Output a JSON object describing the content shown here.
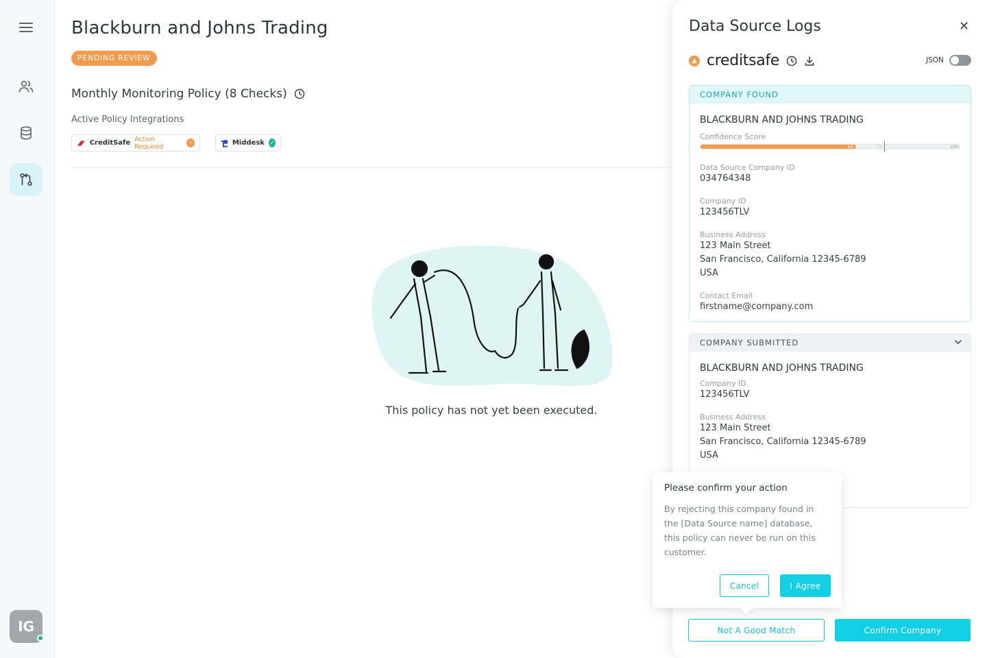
{
  "sidebar": {
    "avatar_initials": "IG",
    "items": [
      {
        "icon": "menu-icon"
      },
      {
        "icon": "users-icon"
      },
      {
        "icon": "database-icon"
      },
      {
        "icon": "policy-flow-icon",
        "active": true
      }
    ]
  },
  "main": {
    "title": "Blackburn and Johns Trading",
    "status": "PENDING REVIEW",
    "policy_title": "Monthly Monitoring Policy (8 Checks)",
    "integrations_label": "Active Policy Integrations",
    "integrations": [
      {
        "name": "CreditSafe",
        "status": "Action Required"
      },
      {
        "name": "Middesk"
      }
    ],
    "empty_message": "This policy has not yet been executed."
  },
  "panel": {
    "title": "Data Source Logs",
    "source_name": "creditsafe",
    "json_label": "JSON",
    "found": {
      "header": "COMPANY FOUND",
      "company_name": "BLACKBURN AND JOHNS TRADING",
      "confidence_label": "Confidence Score",
      "confidence_value": "60",
      "confidence_threshold": "75",
      "confidence_max": "100",
      "confidence_fraction": 0.6,
      "threshold_fraction": 0.71,
      "ds_id_label": "Data Source Company ID",
      "ds_id": "034764348",
      "company_id_label": "Company ID",
      "company_id": "123456TLV",
      "address_label": "Business Address",
      "address_line1": "123 Main Street",
      "address_line2": "San Francisco, California 12345-6789",
      "address_line3": "USA",
      "email_label": "Contact Email",
      "email": "firstname@company.com"
    },
    "submitted": {
      "header": "COMPANY SUBMITTED",
      "company_name": "BLACKBURN AND JOHNS TRADING",
      "company_id_label": "Company ID",
      "company_id": "123456TLV",
      "address_label": "Business Address",
      "address_line1": "123 Main Street",
      "address_line2": "San Francisco, California 12345-6789",
      "address_line3": "USA"
    },
    "not_match_label": "Not A Good Match",
    "confirm_label": "Confirm Company"
  },
  "popover": {
    "title": "Please confirm your action",
    "body": "By rejecting this company found in the [Data Source name] database, this policy can never be run on this customer.",
    "cancel_label": "Cancel",
    "agree_label": "I Agree"
  },
  "colors": {
    "accent": "#12cfe4",
    "warning": "#f29b4e",
    "success": "#1fb39a"
  }
}
